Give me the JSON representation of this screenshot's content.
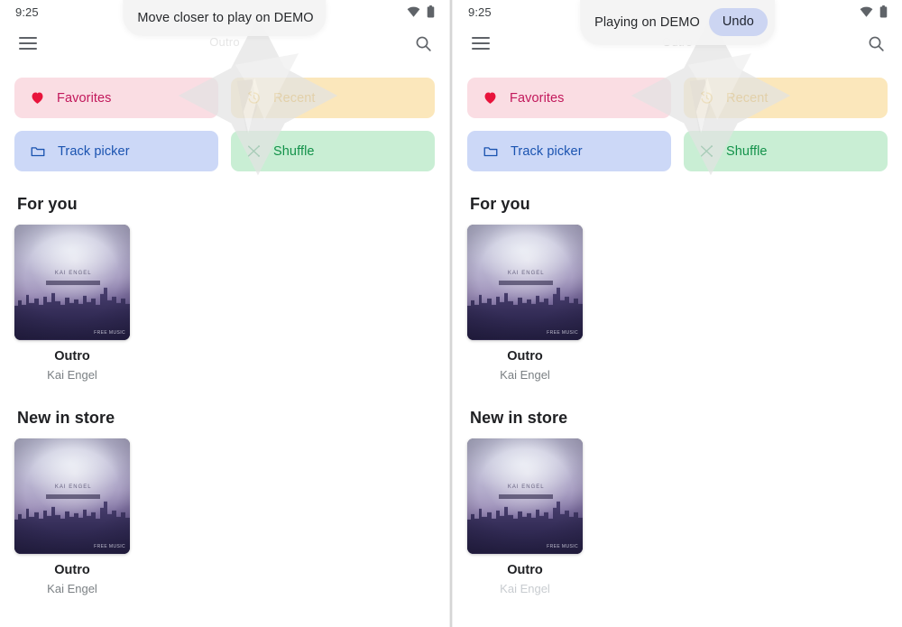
{
  "panels": [
    {
      "id": "left",
      "status": {
        "time": "9:25",
        "wifi_icon": "wifi-icon",
        "battery_icon": "battery-icon"
      },
      "appbar": {
        "menu_icon": "hamburger-menu-icon",
        "search_icon": "search-icon"
      },
      "toast": {
        "message": "Move closer to play on DEMO",
        "action_label": null,
        "ghost_text": "Outro"
      },
      "chips": [
        {
          "label": "Favorites",
          "icon": "heart-icon",
          "bg": "#fadde3",
          "fg": "#c2185b",
          "icon_color": "#e8143c"
        },
        {
          "label": "Recent",
          "icon": "history-icon",
          "bg": "#fbe7bb",
          "fg": "#e0a215",
          "icon_color": "#e3a817"
        },
        {
          "label": "Track picker",
          "icon": "folder-icon",
          "bg": "#ccd8f7",
          "fg": "#1a53b0",
          "icon_color": "#1a53b0"
        },
        {
          "label": "Shuffle",
          "icon": "shuffle-icon",
          "bg": "#c9eed4",
          "fg": "#13924a",
          "icon_color": "#13924a"
        }
      ],
      "sections": [
        {
          "title": "For you",
          "card": {
            "title": "Outro",
            "artist": "Kai Engel",
            "art_title": "KAI ENGEL",
            "art_mark": "FREE MUSIC",
            "faded": false
          }
        },
        {
          "title": "New in store",
          "card": {
            "title": "Outro",
            "artist": "Kai Engel",
            "art_title": "KAI ENGEL",
            "art_mark": "FREE MUSIC",
            "faded": false
          }
        }
      ]
    },
    {
      "id": "right",
      "status": {
        "time": "9:25",
        "wifi_icon": "wifi-icon",
        "battery_icon": "battery-icon"
      },
      "appbar": {
        "menu_icon": "hamburger-menu-icon",
        "search_icon": "search-icon"
      },
      "toast": {
        "message": "Playing on DEMO",
        "action_label": "Undo",
        "ghost_text": "Outro"
      },
      "chips": [
        {
          "label": "Favorites",
          "icon": "heart-icon",
          "bg": "#fadde3",
          "fg": "#c2185b",
          "icon_color": "#e8143c"
        },
        {
          "label": "Recent",
          "icon": "history-icon",
          "bg": "#fbe7bb",
          "fg": "#e0a215",
          "icon_color": "#e3a817"
        },
        {
          "label": "Track picker",
          "icon": "folder-icon",
          "bg": "#ccd8f7",
          "fg": "#1a53b0",
          "icon_color": "#1a53b0"
        },
        {
          "label": "Shuffle",
          "icon": "shuffle-icon",
          "bg": "#c9eed4",
          "fg": "#13924a",
          "icon_color": "#13924a"
        }
      ],
      "sections": [
        {
          "title": "For you",
          "card": {
            "title": "Outro",
            "artist": "Kai Engel",
            "art_title": "KAI ENGEL",
            "art_mark": "FREE MUSIC",
            "faded": false
          }
        },
        {
          "title": "New in store",
          "card": {
            "title": "Outro",
            "artist": "Kai Engel",
            "art_title": "KAI ENGEL",
            "art_mark": "FREE MUSIC",
            "faded": true
          }
        }
      ]
    }
  ],
  "colors": {
    "toast_bg": "#f3f3f3",
    "undo_bg": "#ccd5f2",
    "watermark": "#e4e4e4",
    "text_primary": "#202124",
    "text_secondary": "#7b8084"
  }
}
